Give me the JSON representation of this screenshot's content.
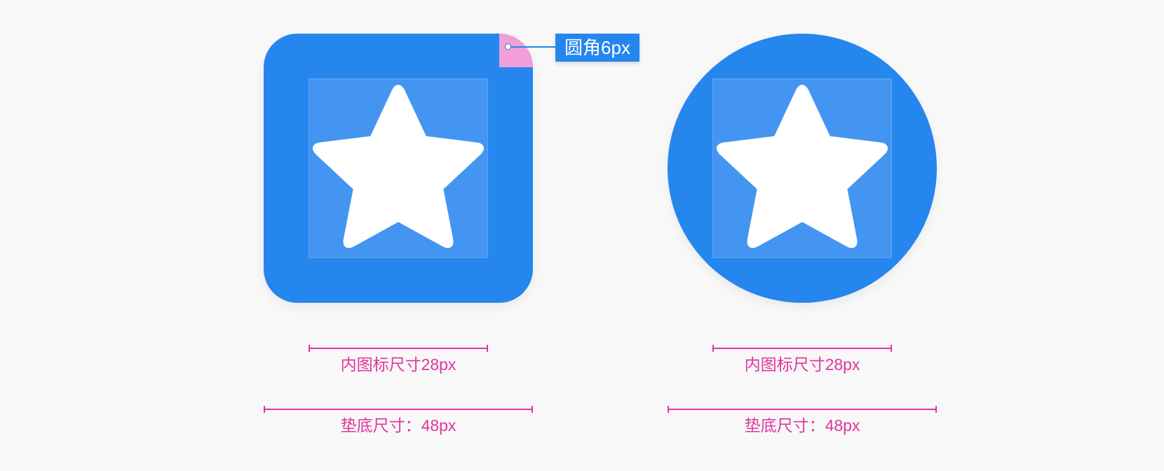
{
  "colors": {
    "background": "#f8f8f8",
    "pad_blue": "#2586ee",
    "inner_blue": "#4395f1",
    "star_white": "#ffffff",
    "corner_pink": "#f29ed8",
    "callout_blue": "#2586ee",
    "dimension_magenta": "#e0359e"
  },
  "icons": {
    "square_icon": "star-icon",
    "circle_icon": "star-icon"
  },
  "callout": {
    "label": "圆角6px"
  },
  "square": {
    "inner_label": "内图标尺寸28px",
    "pad_label": "垫底尺寸：48px"
  },
  "circle": {
    "inner_label": "内图标尺寸28px",
    "pad_label": "垫底尺寸：48px"
  }
}
